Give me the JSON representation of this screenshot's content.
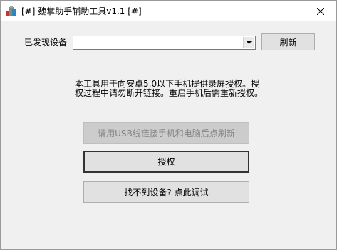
{
  "window": {
    "title": "[#] 魏掌助手辅助工具v1.1 [#]"
  },
  "device": {
    "label": "已发现设备",
    "combo_value": "",
    "refresh_label": "刷新"
  },
  "info": {
    "line1": "本工具用于向安卓5.0以下手机提供录屏授权。授",
    "line2": "权过程中请勿断开链接。重启手机后需重新授权。"
  },
  "buttons": {
    "connect_hint": "请用USB线链接手机和电脑后点刷新",
    "authorize": "授权",
    "debug": "找不到设备? 点此调试"
  },
  "colors": {
    "window_bg": "#f0f0f0",
    "button_bg": "#e1e1e1",
    "disabled_text": "#838383"
  },
  "icons": {
    "app": "app-icon",
    "close": "close-icon",
    "dropdown": "chevron-down-icon"
  }
}
